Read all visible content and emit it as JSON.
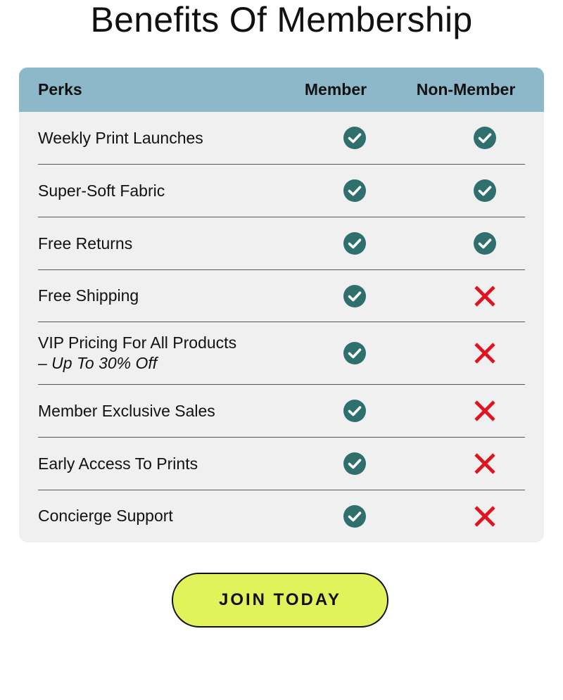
{
  "title": "Benefits Of Membership",
  "colors": {
    "header_bg": "#8db8c9",
    "table_bg": "#f0f0f0",
    "check": "#2f6f6e",
    "cross": "#e0141e",
    "button_bg": "#e2f25a"
  },
  "table": {
    "headers": {
      "perks": "Perks",
      "member": "Member",
      "non_member": "Non-Member"
    },
    "rows": [
      {
        "label": "Weekly Print Launches",
        "sub": "",
        "member": "check-icon",
        "non_member": "check-icon"
      },
      {
        "label": "Super-Soft Fabric",
        "sub": "",
        "member": "check-icon",
        "non_member": "check-icon"
      },
      {
        "label": "Free Returns",
        "sub": "",
        "member": "check-icon",
        "non_member": "check-icon"
      },
      {
        "label": "Free Shipping",
        "sub": "",
        "member": "check-icon",
        "non_member": "cross-icon"
      },
      {
        "label": "VIP Pricing For All Products",
        "sub": "– Up To 30% Off",
        "member": "check-icon",
        "non_member": "cross-icon"
      },
      {
        "label": "Member Exclusive Sales",
        "sub": "",
        "member": "check-icon",
        "non_member": "cross-icon"
      },
      {
        "label": "Early Access To Prints",
        "sub": "",
        "member": "check-icon",
        "non_member": "cross-icon"
      },
      {
        "label": "Concierge Support",
        "sub": "",
        "member": "check-icon",
        "non_member": "cross-icon"
      }
    ]
  },
  "cta": {
    "label": "JOIN TODAY"
  }
}
